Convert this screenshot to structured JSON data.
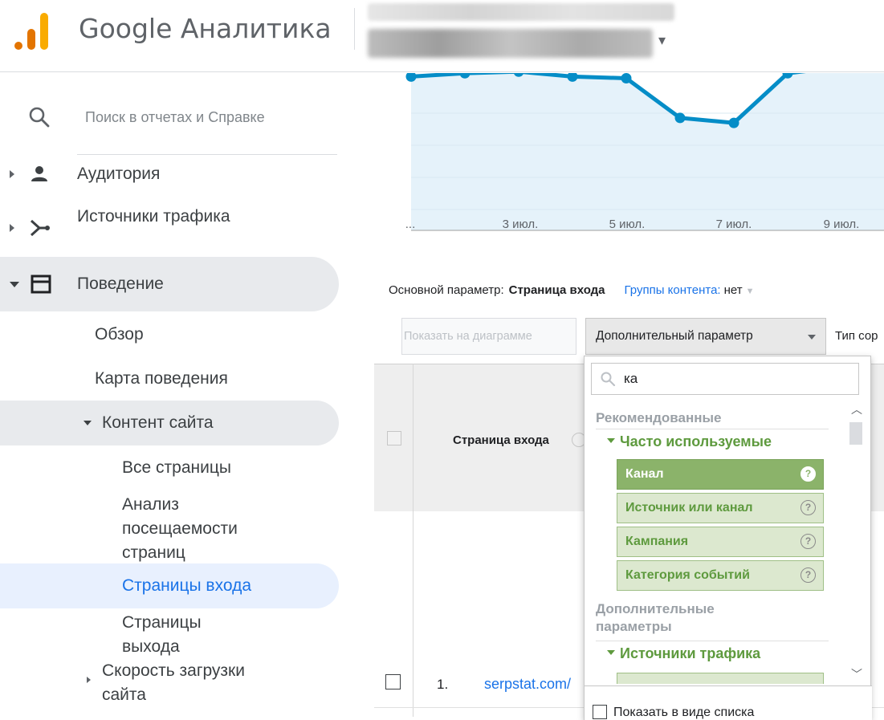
{
  "header": {
    "app_title": "Google Аналитика"
  },
  "sidebar": {
    "search": {
      "placeholder": "Поиск в отчетах и Справке"
    },
    "items": [
      {
        "label": "Аудитория"
      },
      {
        "label": "Источники трафика"
      },
      {
        "label": "Поведение"
      },
      {
        "label": "Обзор"
      },
      {
        "label": "Карта поведения"
      },
      {
        "label": "Контент сайта"
      },
      {
        "label": "Все страницы"
      },
      {
        "label": "Анализ посещаемости страниц"
      },
      {
        "label": "Страницы входа"
      },
      {
        "label": "Страницы выхода"
      },
      {
        "label": "Скорость загрузки сайта"
      }
    ]
  },
  "chart_data": {
    "type": "line",
    "x_ticks": [
      "...",
      "3 июл.",
      "5 июл.",
      "7 июл.",
      "9 июл."
    ],
    "series": [
      {
        "values": [
          0.93,
          0.95,
          0.96,
          0.93,
          0.92,
          0.68,
          0.65,
          0.95,
          0.99
        ]
      }
    ],
    "color": "#058dc7"
  },
  "report": {
    "primary_dimension_label": "Основной параметр:",
    "primary_dimension_value": "Страница входа",
    "content_groups_label": "Группы контента:",
    "content_groups_value": "нет",
    "show_on_chart_button": "Показать на диаграмме",
    "secondary_dimension_button": "Дополнительный параметр",
    "sort_type_label": "Тип сор",
    "table": {
      "column_header": "Страница входа",
      "rows": [
        {
          "index": "1.",
          "page": "serpstat.com/"
        }
      ]
    }
  },
  "dimension_dropdown": {
    "search_value": "ка",
    "sections": [
      {
        "title": "Рекомендованные",
        "groups": [
          {
            "title": "Часто используемые",
            "items": [
              {
                "label": "Канал",
                "selected": true
              },
              {
                "label": "Источник или канал",
                "selected": false
              },
              {
                "label": "Кампания",
                "selected": false
              },
              {
                "label": "Категория событий",
                "selected": false
              }
            ]
          }
        ]
      },
      {
        "title": "Дополнительные параметры",
        "groups": [
          {
            "title": "Источники трафика"
          }
        ]
      }
    ],
    "help_glyph": "?",
    "show_as_list_label": "Показать в виде списка"
  },
  "colors": {
    "accent_blue": "#1a73e8",
    "chart_line": "#058dc7",
    "chart_fill": "#e5f2fa",
    "dimension_green": "#5e9a3e",
    "selected_item": "#8bb36a",
    "logo_orange": "#e37400",
    "logo_yellow": "#f9ab00"
  }
}
